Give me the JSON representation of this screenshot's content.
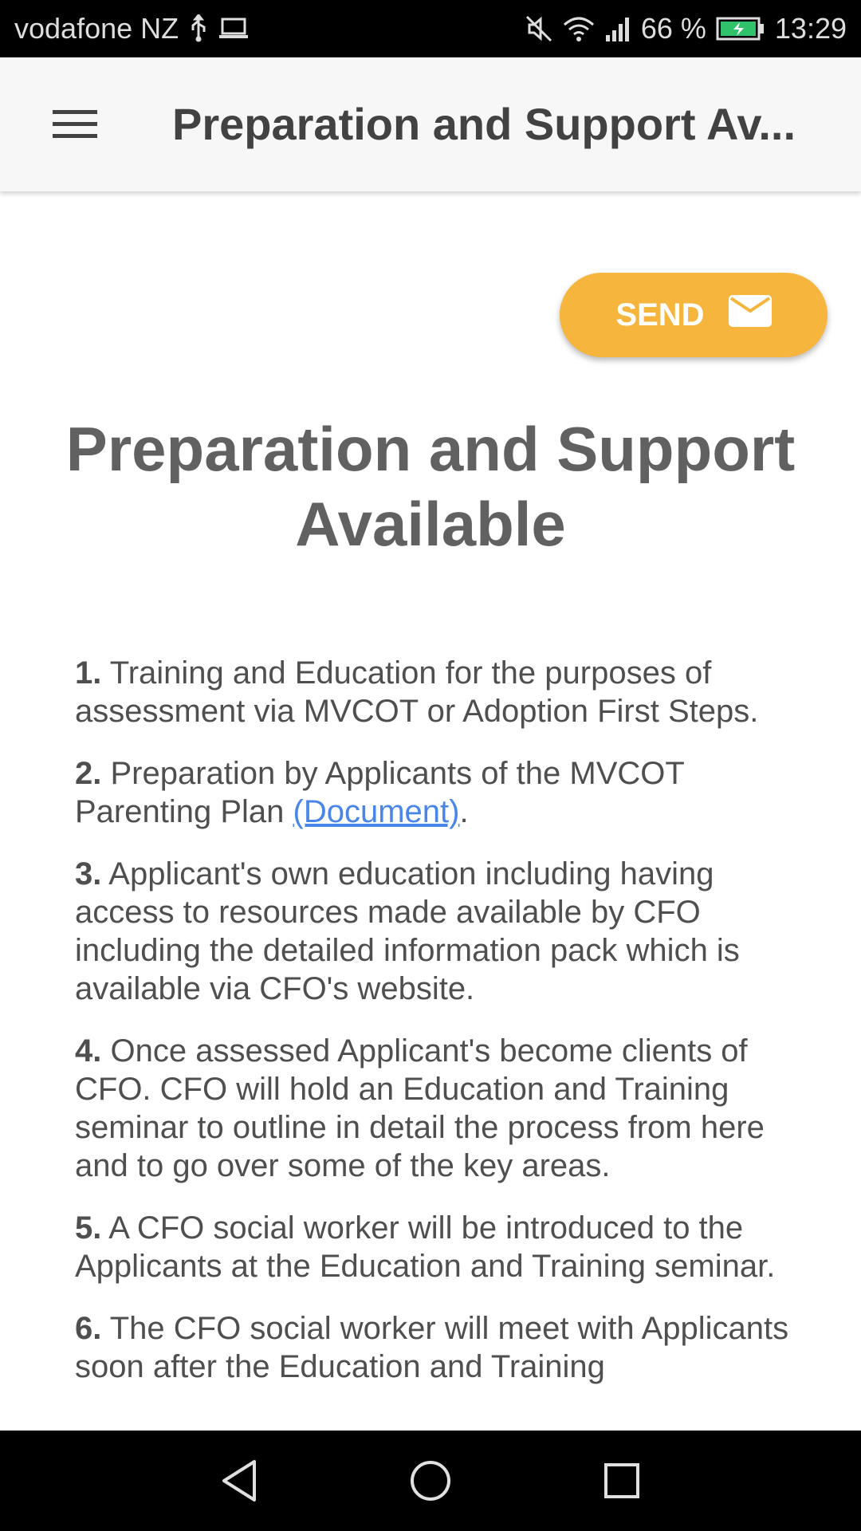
{
  "status_bar": {
    "carrier": "vodafone NZ",
    "battery_percent": "66 %",
    "time": "13:29",
    "icons": [
      "usb-icon",
      "laptop-icon",
      "mute-icon",
      "wifi-icon",
      "signal-icon",
      "battery-charging-icon"
    ]
  },
  "app_bar": {
    "title": "Preparation and Support Av...",
    "menu_icon": "hamburger-menu-icon"
  },
  "send_button": {
    "label": "SEND",
    "icon": "mail-icon",
    "color": "#f6b53c"
  },
  "page": {
    "heading": "Preparation and Support Available",
    "items": [
      {
        "num": "1.",
        "text": "Training and Education for the purposes of assessment via MVCOT or Adoption First Steps."
      },
      {
        "num": "2.",
        "text_before": "Preparation by Applicants of the MVCOT Parenting Plan ",
        "link": "(Document)",
        "text_after": "."
      },
      {
        "num": "3.",
        "text": "Applicant's own education including having access to resources made available by CFO including the detailed information pack which is available via CFO's website."
      },
      {
        "num": "4.",
        "text": "Once assessed Applicant's become clients of CFO. CFO will hold an Education and Training seminar to outline in detail the process from here and to go over some of the key areas."
      },
      {
        "num": "5.",
        "text": "A CFO social worker will be introduced to the Applicants at the Education and Training seminar."
      },
      {
        "num": "6.",
        "text": "The CFO social worker will meet with Applicants soon after the Education and Training"
      }
    ]
  },
  "nav_bar": {
    "icons": [
      "back-icon",
      "home-icon",
      "recents-icon"
    ]
  },
  "colors": {
    "accent": "#f6b53c",
    "link": "#4a86e8",
    "heading": "#616161",
    "body_text": "#4f4f4f"
  }
}
